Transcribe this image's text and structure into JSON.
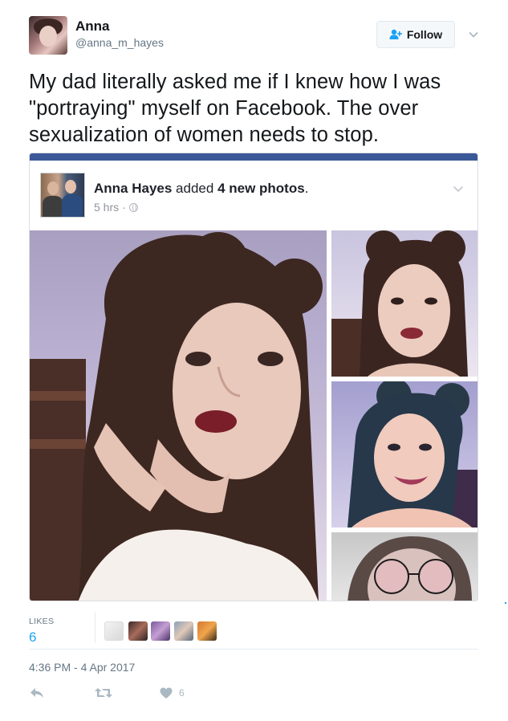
{
  "user": {
    "name": "Anna",
    "handle": "@anna_m_hayes"
  },
  "follow_button": {
    "label": "Follow"
  },
  "tweet": {
    "text": "My dad literally asked me if I knew how I was \"portraying\" myself on Facebook. The over sexualization of women needs to stop."
  },
  "fb_card": {
    "poster": "Anna Hayes",
    "action": " added ",
    "count_text": "4 new photos",
    "period": ".",
    "time": "5 hrs",
    "separator": "·",
    "photo_count": 4,
    "topbar_color": "#3b5998"
  },
  "stats": {
    "likes_label": "LIKES",
    "likes_count": "6",
    "liker_avatars": 5
  },
  "timestamp": "4:36 PM - 4 Apr 2017",
  "actions": {
    "reply_icon": "reply-icon",
    "retweet_icon": "retweet-icon",
    "like_icon": "heart-icon",
    "like_count": "6"
  },
  "colors": {
    "accent": "#1da1f2",
    "text": "#14171a",
    "secondary": "#657786",
    "icon": "#aab8c2"
  }
}
